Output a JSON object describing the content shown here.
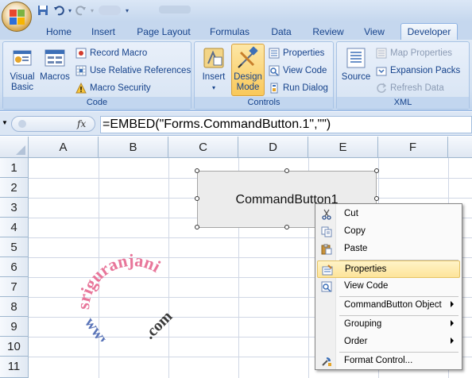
{
  "quick_access": {
    "save_icon": "save-icon",
    "undo_icon": "undo-icon",
    "redo_icon": "redo-icon"
  },
  "tabs": [
    "Home",
    "Insert",
    "Page Layout",
    "Formulas",
    "Data",
    "Review",
    "View",
    "Developer"
  ],
  "active_tab": "Developer",
  "ribbon": {
    "code": {
      "label": "Code",
      "visual_basic": "Visual Basic",
      "macros": "Macros",
      "record_macro": "Record Macro",
      "use_relative": "Use Relative References",
      "macro_security": "Macro Security"
    },
    "controls": {
      "label": "Controls",
      "insert": "Insert",
      "design_mode_line1": "Design",
      "design_mode_line2": "Mode",
      "properties": "Properties",
      "view_code": "View Code",
      "run_dialog": "Run Dialog"
    },
    "xml": {
      "label": "XML",
      "source": "Source",
      "map_properties": "Map Properties",
      "expansion_packs": "Expansion Packs",
      "refresh_data": "Refresh Data"
    }
  },
  "formula_bar": {
    "fx": "fx",
    "formula": "=EMBED(\"Forms.CommandButton.1\",\"\")"
  },
  "columns": [
    "A",
    "B",
    "C",
    "D",
    "E",
    "F"
  ],
  "rows": [
    "1",
    "2",
    "3",
    "4",
    "5",
    "6",
    "7",
    "8",
    "9",
    "10",
    "11"
  ],
  "command_button": {
    "caption": "CommandButton1"
  },
  "watermark": {
    "text_pink": "sriguranjani",
    "text_blue": "www.",
    "text_dark": ".com"
  },
  "context_menu": {
    "items": [
      {
        "label": "Cut",
        "icon": "scissors-icon",
        "submenu": false
      },
      {
        "label": "Copy",
        "icon": "copy-icon",
        "submenu": false
      },
      {
        "label": "Paste",
        "icon": "paste-icon",
        "submenu": false
      },
      {
        "label": "Properties",
        "icon": "properties-icon",
        "submenu": false,
        "highlighted": true
      },
      {
        "label": "View Code",
        "icon": "view-code-icon",
        "submenu": false
      },
      {
        "label": "CommandButton Object",
        "icon": "",
        "submenu": true
      },
      {
        "label": "Grouping",
        "icon": "",
        "submenu": true
      },
      {
        "label": "Order",
        "icon": "",
        "submenu": true
      },
      {
        "label": "Format Control...",
        "icon": "format-control-icon",
        "submenu": false
      }
    ]
  },
  "colors": {
    "ribbon_text": "#15428b",
    "highlight": "#fde49a",
    "watermark_pink": "#e8769a",
    "watermark_blue": "#5a74b8",
    "watermark_dark": "#3a3a3a"
  }
}
